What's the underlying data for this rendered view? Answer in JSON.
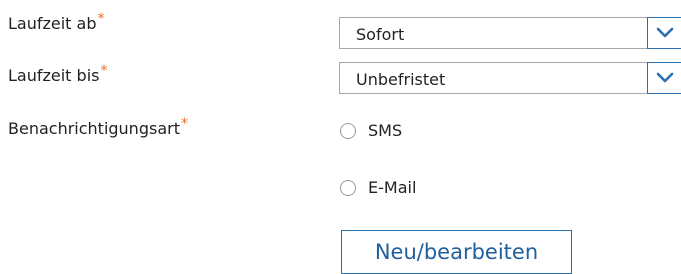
{
  "form": {
    "required_mark": "*",
    "laufzeit_ab": {
      "label": "Laufzeit ab",
      "value": "Sofort"
    },
    "laufzeit_bis": {
      "label": "Laufzeit bis",
      "value": "Unbefristet"
    },
    "benachrichtigungsart": {
      "label": "Benachrichtigungsart",
      "options": [
        {
          "label": "SMS",
          "selected": false
        },
        {
          "label": "E-Mail",
          "selected": false
        }
      ]
    },
    "edit_button_label": "Neu/bearbeiten"
  },
  "icons": {
    "dropdown": "chevron-down-icon"
  },
  "colors": {
    "required": "#e8702a",
    "accent": "#2a6fb0",
    "button_text": "#1f5f9e"
  }
}
